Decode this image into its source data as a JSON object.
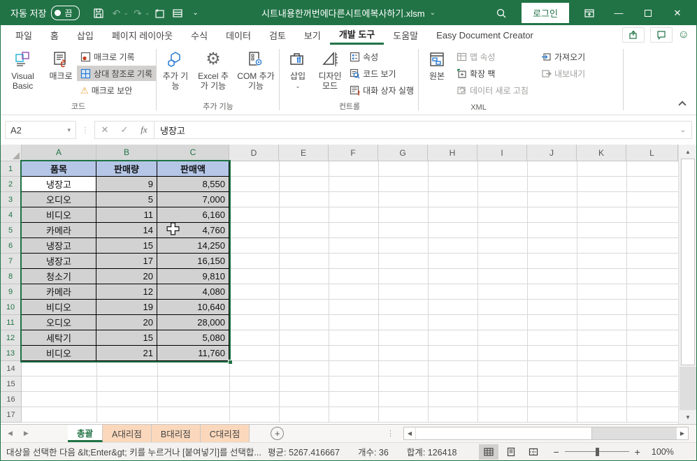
{
  "colors": {
    "accent_green": "#217346",
    "table_header_fill": "#B5C6E7",
    "selection_gray": "#D2D2D2",
    "sheet_tab_fill": "#FBD8BC"
  },
  "icons": {
    "warning": "⚠",
    "gear": "⚙",
    "smiley": "☺",
    "up_arrow": "▲",
    "down_arrow": "▼",
    "left_arrow": "◀",
    "right_arrow": "▶",
    "close": "✕",
    "check": "✓",
    "fx": "fx",
    "caret_down": "▾",
    "chevron_down": "⌄",
    "minimize": "—",
    "dots_vertical": "⋮",
    "plus": "+",
    "undo": "↶",
    "redo": "↷"
  },
  "titlebar": {
    "autosave_label": "자동 저장",
    "autosave_state": "끔",
    "title": "시트내용한꺼번에다른시트에복사하기.xlsm",
    "login": "로그인"
  },
  "ribbon": {
    "tabs": [
      {
        "label": "파일"
      },
      {
        "label": "홈"
      },
      {
        "label": "삽입"
      },
      {
        "label": "페이지 레이아웃"
      },
      {
        "label": "수식"
      },
      {
        "label": "데이터"
      },
      {
        "label": "검토"
      },
      {
        "label": "보기"
      },
      {
        "label": "개발 도구",
        "active": true
      },
      {
        "label": "도움말"
      },
      {
        "label": "Easy Document Creator"
      }
    ],
    "code_group": {
      "label": "코드",
      "visual_basic": "Visual Basic",
      "macros": "매크로",
      "record_macro": "매크로 기록",
      "relative_refs": "상대 참조로 기록",
      "macro_security": "매크로 보안"
    },
    "addins_group": {
      "label": "추가 기능",
      "addins": "추가 기능",
      "excel_addins": "Excel 추가 기능",
      "com_addins": "COM 추가 기능"
    },
    "controls_group": {
      "label": "컨트롤",
      "insert": "삽입",
      "design_mode": "디자인 모드",
      "properties": "속성",
      "view_code": "코드 보기",
      "run_dialog": "대화 상자 실행"
    },
    "xml_group": {
      "label": "XML",
      "source": "원본",
      "map_properties": "맵 속성",
      "expansion_packs": "확장 팩",
      "refresh_data": "데이터 새로 고침",
      "import": "가져오기",
      "export": "내보내기"
    }
  },
  "formula_bar": {
    "name_box": "A2",
    "value": "냉장고"
  },
  "sheet": {
    "columns": [
      "A",
      "B",
      "C",
      "D",
      "E",
      "F",
      "G",
      "H",
      "I",
      "J",
      "K",
      "L"
    ],
    "row_numbers": [
      "1",
      "2",
      "3",
      "4",
      "5",
      "6",
      "7",
      "8",
      "9",
      "10",
      "11",
      "12",
      "13",
      "14",
      "15",
      "16",
      "17"
    ],
    "table": {
      "headers": [
        "품목",
        "판매량",
        "판매액"
      ],
      "rows": [
        [
          "냉장고",
          "9",
          "8,550"
        ],
        [
          "오디오",
          "5",
          "7,000"
        ],
        [
          "비디오",
          "11",
          "6,160"
        ],
        [
          "카메라",
          "14",
          "4,760"
        ],
        [
          "냉장고",
          "15",
          "14,250"
        ],
        [
          "냉장고",
          "17",
          "16,150"
        ],
        [
          "청소기",
          "20",
          "9,810"
        ],
        [
          "카메라",
          "12",
          "4,080"
        ],
        [
          "비디오",
          "19",
          "10,640"
        ],
        [
          "오디오",
          "20",
          "28,000"
        ],
        [
          "세탁기",
          "15",
          "5,080"
        ],
        [
          "비디오",
          "21",
          "11,760"
        ]
      ]
    }
  },
  "sheet_tabs": [
    {
      "label": "총괄",
      "active": true
    },
    {
      "label": "A대리점"
    },
    {
      "label": "B대리점"
    },
    {
      "label": "C대리점"
    }
  ],
  "status_bar": {
    "message": "대상을 선택한 다음 &lt;Enter&gt; 키를 누르거나 [붙여넣기]를 선택합...",
    "average": "평균: 5267.416667",
    "count": "개수: 36",
    "sum": "합계: 126418",
    "zoom_level": "100%"
  }
}
